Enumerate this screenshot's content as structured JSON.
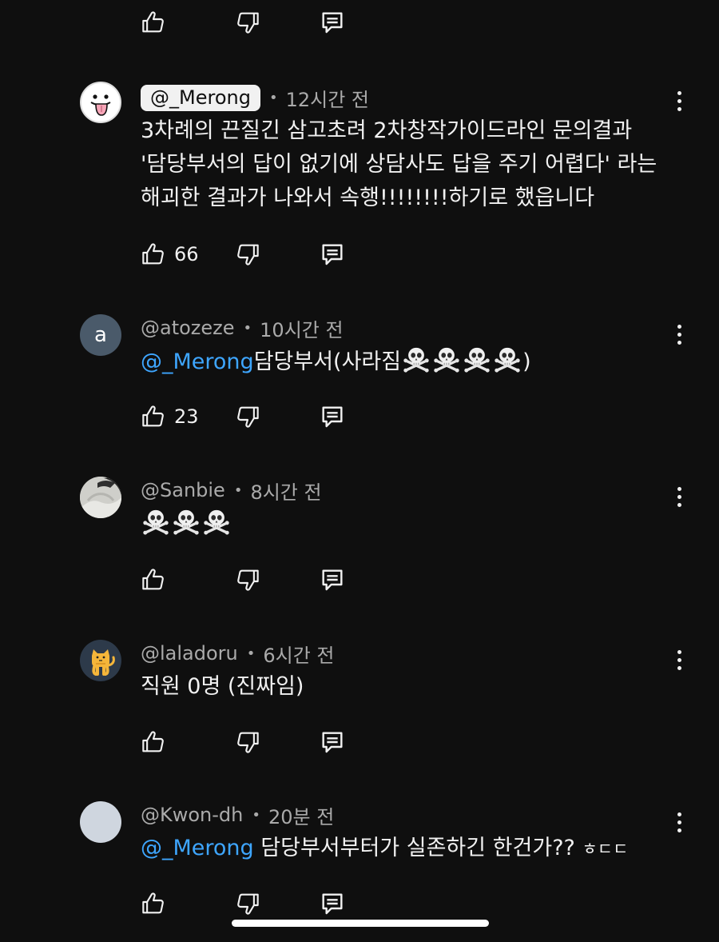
{
  "top_actions": {
    "like_count": ""
  },
  "comments": [
    {
      "author": "@_Merong",
      "time": "12시간 전",
      "lines": [
        "3차례의 끈질긴 삼고초려 2차창작가이드라인 문의결과",
        "'담당부서의 답이 없기에 상담사도 답을 주기 어렵다' 라는",
        "해괴한 결과가 나와서 속행!!!!!!!!하기로 했읍니다"
      ],
      "likes": "66"
    },
    {
      "author": "@atozeze",
      "avatar_letter": "a",
      "time": "10시간 전",
      "mention": "@_Merong",
      "text_before": "담당부서(사라짐",
      "text_after": ")",
      "likes": "23"
    },
    {
      "author": "@Sanbie",
      "time": "8시간 전",
      "likes": ""
    },
    {
      "author": "@laladoru",
      "time": "6시간 전",
      "text": "직원 0명 (진짜임)",
      "likes": ""
    },
    {
      "author": "@Kwon-dh",
      "time": "20분 전",
      "mention": "@_Merong",
      "text": " 담당부서부터가 실존하긴 한건가?? ",
      "small_text": "ㅎㄷㄷ",
      "likes": ""
    }
  ],
  "icons": {
    "like": "thumbs-up-icon",
    "dislike": "thumbs-down-icon",
    "reply": "reply-icon",
    "menu": "more-vertical-icon",
    "skull": "skull-crossbones-emoji"
  },
  "colors": {
    "background": "#0f0f0f",
    "mention": "#3ea6ff",
    "secondary_text": "#aaaaaa"
  }
}
